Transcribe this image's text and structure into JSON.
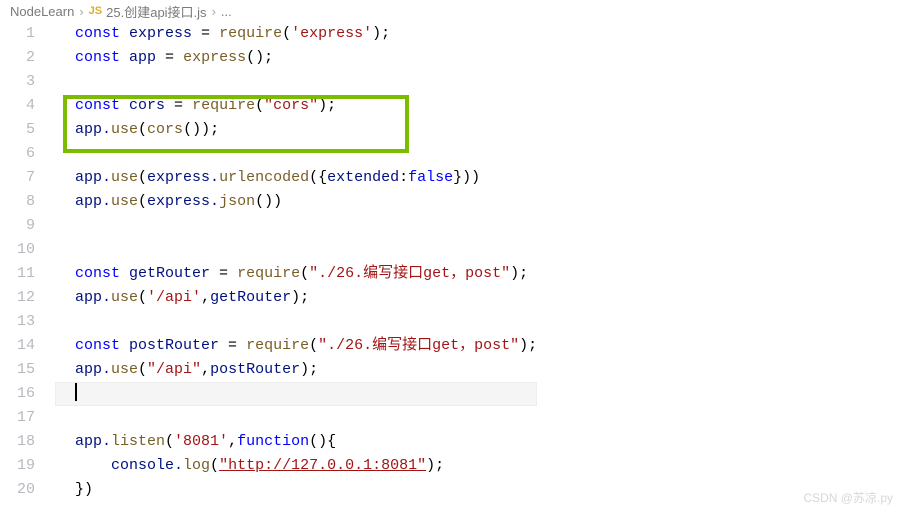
{
  "breadcrumb": {
    "root": "NodeLearn",
    "js_label": "JS",
    "file": "25.创建api接口.js",
    "ellipsis": "..."
  },
  "lines": {
    "l1": {
      "p1": "const",
      "p2": " express ",
      "p3": "=",
      "p4": " ",
      "p5": "require",
      "p6": "(",
      "p7": "'express'",
      "p8": ");"
    },
    "l2": {
      "p1": "const",
      "p2": " app ",
      "p3": "=",
      "p4": " ",
      "p5": "express",
      "p6": "();"
    },
    "l4": {
      "p1": "const",
      "p2": " cors ",
      "p3": "=",
      "p4": " ",
      "p5": "require",
      "p6": "(",
      "p7": "\"cors\"",
      "p8": ");"
    },
    "l5": {
      "p1": "app.",
      "p2": "use",
      "p3": "(",
      "p4": "cors",
      "p5": "());"
    },
    "l7": {
      "p1": "app.",
      "p2": "use",
      "p3": "(",
      "p4": "express.",
      "p5": "urlencoded",
      "p6": "({",
      "p7": "extended",
      "p8": ":",
      "p9": "false",
      "p10": "}))"
    },
    "l8": {
      "p1": "app.",
      "p2": "use",
      "p3": "(",
      "p4": "express.",
      "p5": "json",
      "p6": "())"
    },
    "l11": {
      "p1": "const",
      "p2": " getRouter ",
      "p3": "=",
      "p4": " ",
      "p5": "require",
      "p6": "(",
      "p7": "\"./26.编写接口get，post\"",
      "p8": ");"
    },
    "l12": {
      "p1": "app.",
      "p2": "use",
      "p3": "(",
      "p4": "'/api'",
      "p5": ",",
      "p6": "getRouter",
      "p7": ");"
    },
    "l14": {
      "p1": "const",
      "p2": " postRouter ",
      "p3": "=",
      "p4": " ",
      "p5": "require",
      "p6": "(",
      "p7": "\"./26.编写接口get，post\"",
      "p8": ");"
    },
    "l15": {
      "p1": "app.",
      "p2": "use",
      "p3": "(",
      "p4": "\"/api\"",
      "p5": ",",
      "p6": "postRouter",
      "p7": ");"
    },
    "l18": {
      "p1": "app.",
      "p2": "listen",
      "p3": "(",
      "p4": "'8081'",
      "p5": ",",
      "p6": "function",
      "p7": "(){"
    },
    "l19": {
      "p1": "    console.",
      "p2": "log",
      "p3": "(",
      "p4": "\"http://127.0.0.1:8081\"",
      "p5": ");"
    },
    "l20": {
      "p1": "})"
    }
  },
  "line_numbers": [
    "1",
    "2",
    "3",
    "4",
    "5",
    "6",
    "7",
    "8",
    "9",
    "10",
    "11",
    "12",
    "13",
    "14",
    "15",
    "16",
    "17",
    "18",
    "19",
    "20"
  ],
  "watermark": "CSDN @苏凉.py"
}
